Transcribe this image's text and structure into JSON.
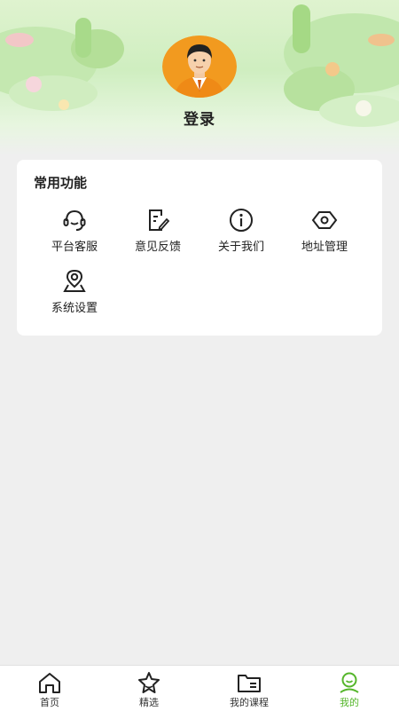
{
  "profile": {
    "login_label": "登录"
  },
  "common": {
    "title": "常用功能",
    "items": [
      {
        "label": "平台客服",
        "icon": "headset-icon"
      },
      {
        "label": "意见反馈",
        "icon": "feedback-edit-icon"
      },
      {
        "label": "关于我们",
        "icon": "info-icon"
      },
      {
        "label": "地址管理",
        "icon": "hexagon-eye-icon"
      },
      {
        "label": "系统设置",
        "icon": "location-pin-icon"
      }
    ]
  },
  "tabbar": {
    "items": [
      {
        "label": "首页",
        "icon": "home-icon",
        "active": false
      },
      {
        "label": "精选",
        "icon": "star-icon",
        "active": false
      },
      {
        "label": "我的课程",
        "icon": "folder-icon",
        "active": false
      },
      {
        "label": "我的",
        "icon": "user-icon",
        "active": true
      }
    ]
  },
  "colors": {
    "accent": "#55b62b",
    "background": "#efefef",
    "card": "#ffffff",
    "avatar_orange": "#f29a1f"
  }
}
